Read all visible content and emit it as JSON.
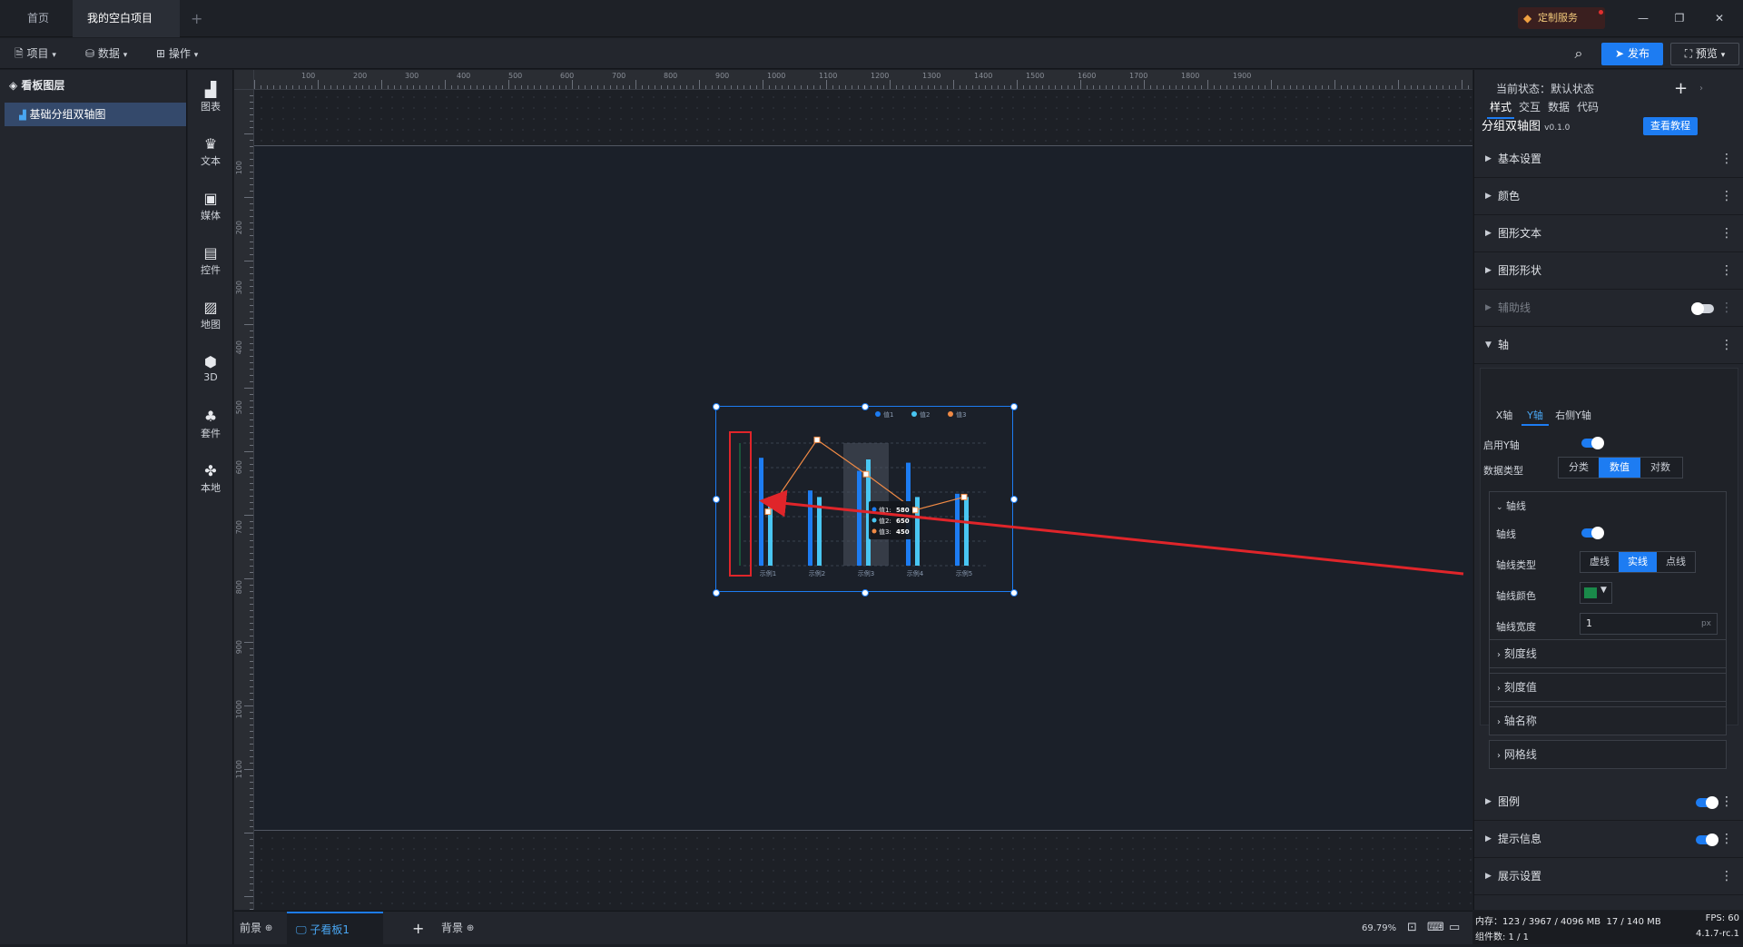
{
  "titlebar": {
    "tabs": [
      {
        "label": "首页"
      },
      {
        "label": "我的空白项目"
      }
    ],
    "add_tab": "+",
    "custom_service": "定制服务",
    "win": {
      "minimize": "—",
      "restore": "❐",
      "close": "✕"
    }
  },
  "menubar": {
    "items": [
      {
        "label": "项目"
      },
      {
        "label": "数据"
      },
      {
        "label": "操作"
      }
    ],
    "publish": "发布",
    "preview": "预览"
  },
  "layers": {
    "title": "看板图层",
    "items": [
      {
        "label": "基础分组双轴图"
      }
    ]
  },
  "components": [
    {
      "label": "图表",
      "icon": "bar-chart-icon"
    },
    {
      "label": "文本",
      "icon": "text-icon"
    },
    {
      "label": "媒体",
      "icon": "media-icon"
    },
    {
      "label": "控件",
      "icon": "control-icon"
    },
    {
      "label": "地图",
      "icon": "map-icon"
    },
    {
      "label": "3D",
      "icon": "cube-icon"
    },
    {
      "label": "套件",
      "icon": "suite-icon"
    },
    {
      "label": "本地",
      "icon": "puzzle-icon"
    }
  ],
  "ruler": {
    "top": [
      "100",
      "200",
      "300",
      "400",
      "500",
      "600",
      "700",
      "800",
      "900",
      "1000",
      "1100",
      "1200",
      "1300",
      "1400",
      "1500",
      "1600",
      "1700",
      "1800",
      "1900"
    ],
    "left": [
      "100",
      "200",
      "300",
      "400",
      "500",
      "600",
      "700",
      "800",
      "900",
      "1000",
      "1100"
    ]
  },
  "chart_data": {
    "type": "bar",
    "categories": [
      "示例1",
      "示例2",
      "示例3",
      "示例4",
      "示例5"
    ],
    "series": [
      {
        "name": "值1",
        "kind": "bar",
        "color": "#1d7cf2",
        "values": [
          660,
          460,
          580,
          630,
          440
        ]
      },
      {
        "name": "值2",
        "kind": "bar",
        "color": "#49c6f2",
        "values": [
          420,
          420,
          650,
          420,
          420
        ]
      },
      {
        "name": "值3",
        "kind": "line",
        "color": "#f08a45",
        "values": [
          330,
          770,
          560,
          340,
          420
        ]
      }
    ],
    "ylim": [
      0,
      750
    ],
    "legend": "top-right",
    "tooltip": {
      "rows": [
        {
          "label": "值1:",
          "value": "580",
          "color": "#1d7cf2"
        },
        {
          "label": "值2:",
          "value": "650",
          "color": "#49c6f2"
        },
        {
          "label": "值3:",
          "value": "450",
          "color": "#f08a45"
        }
      ]
    },
    "axis_color": "#1a8a4a"
  },
  "bottom": {
    "tabs": [
      {
        "label": "前景"
      },
      {
        "label": "子看板1"
      },
      {
        "label": "背景"
      }
    ],
    "add": "+",
    "zoom": "69.79%"
  },
  "status": {
    "memory_label": "内存：",
    "memory": "123 / 3967 / 4096 MB",
    "heap": "17 / 140 MB",
    "fps": "FPS:  60",
    "count": "组件数: 1 / 1",
    "version": "4.1.7-rc.1"
  },
  "panel": {
    "state": "当前状态：默认状态",
    "plus": "+",
    "tabs": [
      {
        "label": "样式"
      },
      {
        "label": "交互"
      },
      {
        "label": "数据"
      },
      {
        "label": "代码"
      }
    ],
    "component_name": "分组双轴图",
    "version": "v0.1.0",
    "tutorial": "查看教程",
    "sections": [
      {
        "label": "基本设置"
      },
      {
        "label": "颜色"
      },
      {
        "label": "图形文本"
      },
      {
        "label": "图形形状"
      },
      {
        "label": "辅助线"
      },
      {
        "label": "轴"
      }
    ],
    "axis_tabs": [
      {
        "label": "X轴"
      },
      {
        "label": "Y轴"
      },
      {
        "label": "右侧Y轴"
      }
    ],
    "enable_y": "启用Y轴",
    "data_type": {
      "label": "数据类型",
      "options": [
        "分类",
        "数值",
        "对数"
      ],
      "selected": "数值"
    },
    "axis_line": {
      "title": "轴线",
      "switch": "轴线",
      "type_label": "轴线类型",
      "type_options": [
        "虚线",
        "实线",
        "点线"
      ],
      "type_selected": "实线",
      "color_label": "轴线颜色",
      "color": "#1a8a4a",
      "width_label": "轴线宽度",
      "width": "1",
      "unit": "px"
    },
    "subsections": [
      {
        "label": "刻度线"
      },
      {
        "label": "刻度值"
      },
      {
        "label": "轴名称"
      },
      {
        "label": "网格线"
      }
    ],
    "bottom_sections": [
      {
        "label": "图例"
      },
      {
        "label": "提示信息"
      },
      {
        "label": "展示设置"
      }
    ]
  }
}
